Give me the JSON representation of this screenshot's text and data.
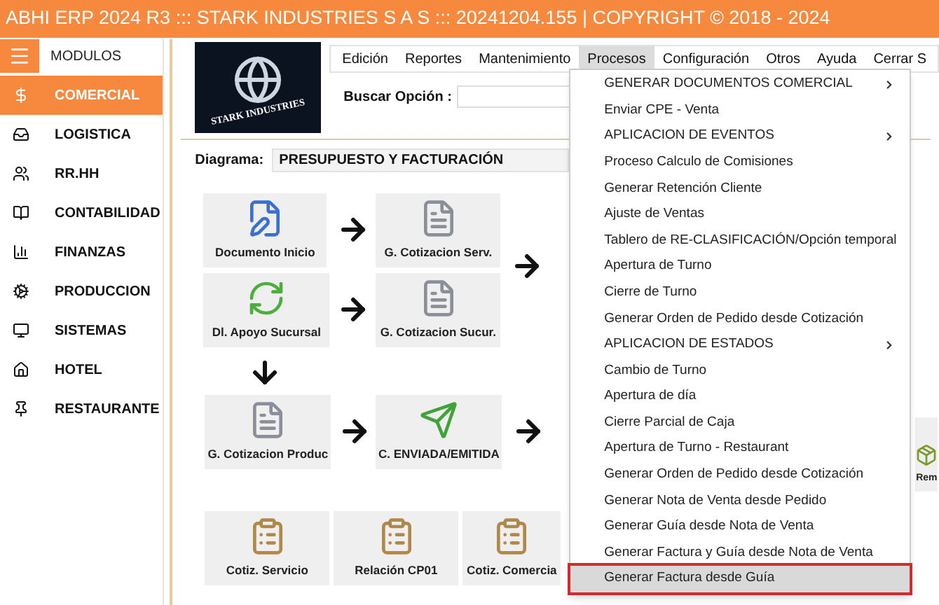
{
  "window": {
    "title": "ABHI ERP 2024 R3 ::: STARK INDUSTRIES S A S ::: 20241204.155 | COPYRIGHT ©  2018 - 2024"
  },
  "sidebar": {
    "header": "MODULOS",
    "items": [
      {
        "label": "COMERCIAL",
        "selected": true
      },
      {
        "label": "LOGISTICA",
        "selected": false
      },
      {
        "label": "RR.HH",
        "selected": false
      },
      {
        "label": "CONTABILIDAD",
        "selected": false
      },
      {
        "label": "FINANZAS",
        "selected": false
      },
      {
        "label": "PRODUCCION",
        "selected": false
      },
      {
        "label": "SISTEMAS",
        "selected": false
      },
      {
        "label": "HOTEL",
        "selected": false
      },
      {
        "label": "RESTAURANTE",
        "selected": false
      }
    ]
  },
  "logo": {
    "text": "STARK INDUSTRIES"
  },
  "menubar": [
    {
      "label": "Edición",
      "selected": false
    },
    {
      "label": "Reportes",
      "selected": false
    },
    {
      "label": "Mantenimiento",
      "selected": false
    },
    {
      "label": "Procesos",
      "selected": true
    },
    {
      "label": "Configuración",
      "selected": false
    },
    {
      "label": "Otros",
      "selected": false
    },
    {
      "label": "Ayuda",
      "selected": false
    },
    {
      "label": "Cerrar S",
      "selected": false
    }
  ],
  "search": {
    "label": "Buscar Opción :"
  },
  "diagram": {
    "label": "Diagrama:",
    "value": "PRESUPUESTO Y FACTURACIÓN",
    "nodes": [
      {
        "label": "Documento Inicio",
        "kind": "pen"
      },
      {
        "label": "G. Cotizacion Serv.",
        "kind": "sheet"
      },
      {
        "label": "Dl. Apoyo Sucursal",
        "kind": "cycle"
      },
      {
        "label": "G. Cotizacion Sucur.",
        "kind": "sheet"
      },
      {
        "label": "G. Cotizacion Produc",
        "kind": "sheet"
      },
      {
        "label": "C. ENVIADA/EMITIDA",
        "kind": "send"
      },
      {
        "label": "Cotiz. Servicio",
        "kind": "clipboard"
      },
      {
        "label": "Relación CP01",
        "kind": "clipboard"
      },
      {
        "label": "Cotiz. Comercia",
        "kind": "clipboard"
      },
      {
        "label": "Rem",
        "kind": "box"
      }
    ]
  },
  "dropdown": {
    "items": [
      {
        "label": "GENERAR DOCUMENTOS COMERCIAL",
        "submenu": true,
        "selected": false
      },
      {
        "label": "Enviar CPE - Venta",
        "submenu": false,
        "selected": false
      },
      {
        "label": "APLICACION DE EVENTOS",
        "submenu": true,
        "selected": false
      },
      {
        "label": "Proceso Calculo de Comisiones",
        "submenu": false,
        "selected": false
      },
      {
        "label": "Generar Retención Cliente",
        "submenu": false,
        "selected": false
      },
      {
        "label": "Ajuste de Ventas",
        "submenu": false,
        "selected": false
      },
      {
        "label": "Tablero de RE-CLASIFICACIÓN/Opción temporal",
        "submenu": false,
        "selected": false
      },
      {
        "label": "Apertura de Turno",
        "submenu": false,
        "selected": false
      },
      {
        "label": "Cierre de Turno",
        "submenu": false,
        "selected": false
      },
      {
        "label": "Generar Orden de Pedido desde Cotización",
        "submenu": false,
        "selected": false
      },
      {
        "label": "APLICACION DE ESTADOS",
        "submenu": true,
        "selected": false
      },
      {
        "label": "Cambio de Turno",
        "submenu": false,
        "selected": false
      },
      {
        "label": "Apertura de día",
        "submenu": false,
        "selected": false
      },
      {
        "label": "Cierre Parcial de Caja",
        "submenu": false,
        "selected": false
      },
      {
        "label": "Apertura de Turno - Restaurant",
        "submenu": false,
        "selected": false
      },
      {
        "label": "Generar Orden de Pedido desde Cotización",
        "submenu": false,
        "selected": false
      },
      {
        "label": "Generar Nota de Venta desde Pedido",
        "submenu": false,
        "selected": false
      },
      {
        "label": "Generar Guía desde Nota de Venta",
        "submenu": false,
        "selected": false
      },
      {
        "label": "Generar Factura y Guía desde Nota de Venta",
        "submenu": false,
        "selected": false
      },
      {
        "label": "Generar Factura desde Guía",
        "submenu": false,
        "selected": true
      }
    ]
  }
}
